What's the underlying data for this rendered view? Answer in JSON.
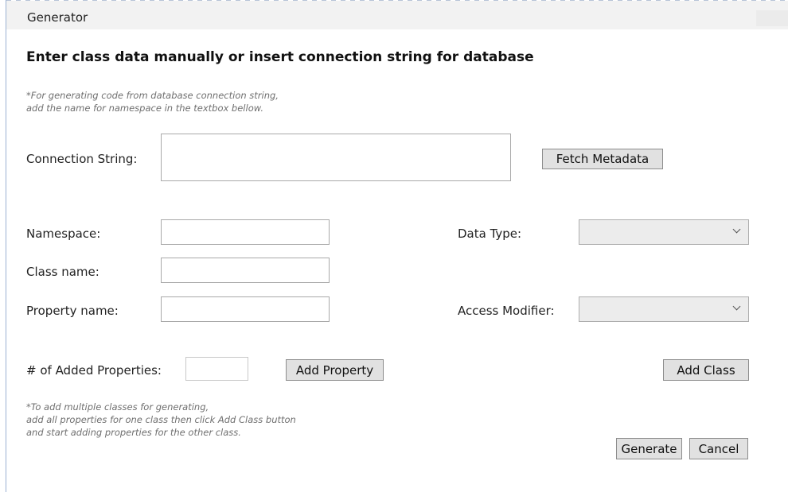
{
  "window": {
    "title": "Generator"
  },
  "heading": "Enter class data manually or insert connection string for database",
  "notes": {
    "connection_hint_line1": "*For generating code from database connection string,",
    "connection_hint_line2": "add the name for namespace in the textbox bellow.",
    "class_hint_line1": "*To add multiple classes for generating,",
    "class_hint_line2": "add all properties for one class then click Add Class button",
    "class_hint_line3": "and start adding properties for the other class."
  },
  "form": {
    "connection_string": {
      "label": "Connection String:",
      "value": ""
    },
    "namespace": {
      "label": "Namespace:",
      "value": ""
    },
    "class_name": {
      "label": "Class name:",
      "value": ""
    },
    "property_name": {
      "label": "Property name:",
      "value": ""
    },
    "data_type": {
      "label": "Data Type:",
      "selected": ""
    },
    "access_modifier": {
      "label": "Access Modifier:",
      "selected": ""
    },
    "added_properties": {
      "label": "# of Added Properties:",
      "value": ""
    }
  },
  "buttons": {
    "fetch_metadata": "Fetch Metadata",
    "add_property": "Add Property",
    "add_class": "Add Class",
    "generate": "Generate",
    "cancel": "Cancel"
  },
  "icons": {
    "dropdown": "chevron-down-icon"
  }
}
